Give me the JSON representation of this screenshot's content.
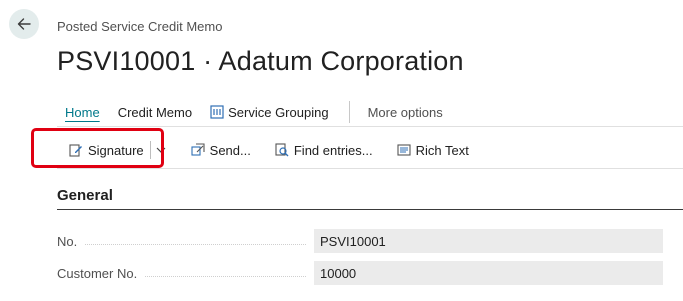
{
  "header": {
    "breadcrumb": "Posted Service Credit Memo",
    "title": "PSVI10001 · Adatum Corporation"
  },
  "tabs": [
    {
      "label": "Home",
      "active": true
    },
    {
      "label": "Credit Memo"
    },
    {
      "label": "Service Grouping",
      "icon": "service-grouping-icon"
    },
    {
      "label": "More options"
    }
  ],
  "actions": [
    {
      "label": "Signature",
      "icon": "signature-icon"
    },
    {
      "label": "Send...",
      "icon": "send-icon"
    },
    {
      "label": "Find entries...",
      "icon": "find-entries-icon"
    },
    {
      "label": "Rich Text",
      "icon": "rich-text-icon"
    }
  ],
  "section": {
    "title": "General",
    "fields": [
      {
        "label": "No.",
        "value": "PSVI10001"
      },
      {
        "label": "Customer No.",
        "value": "10000"
      }
    ]
  },
  "colors": {
    "accent": "#00788a",
    "highlight": "#e00012"
  }
}
